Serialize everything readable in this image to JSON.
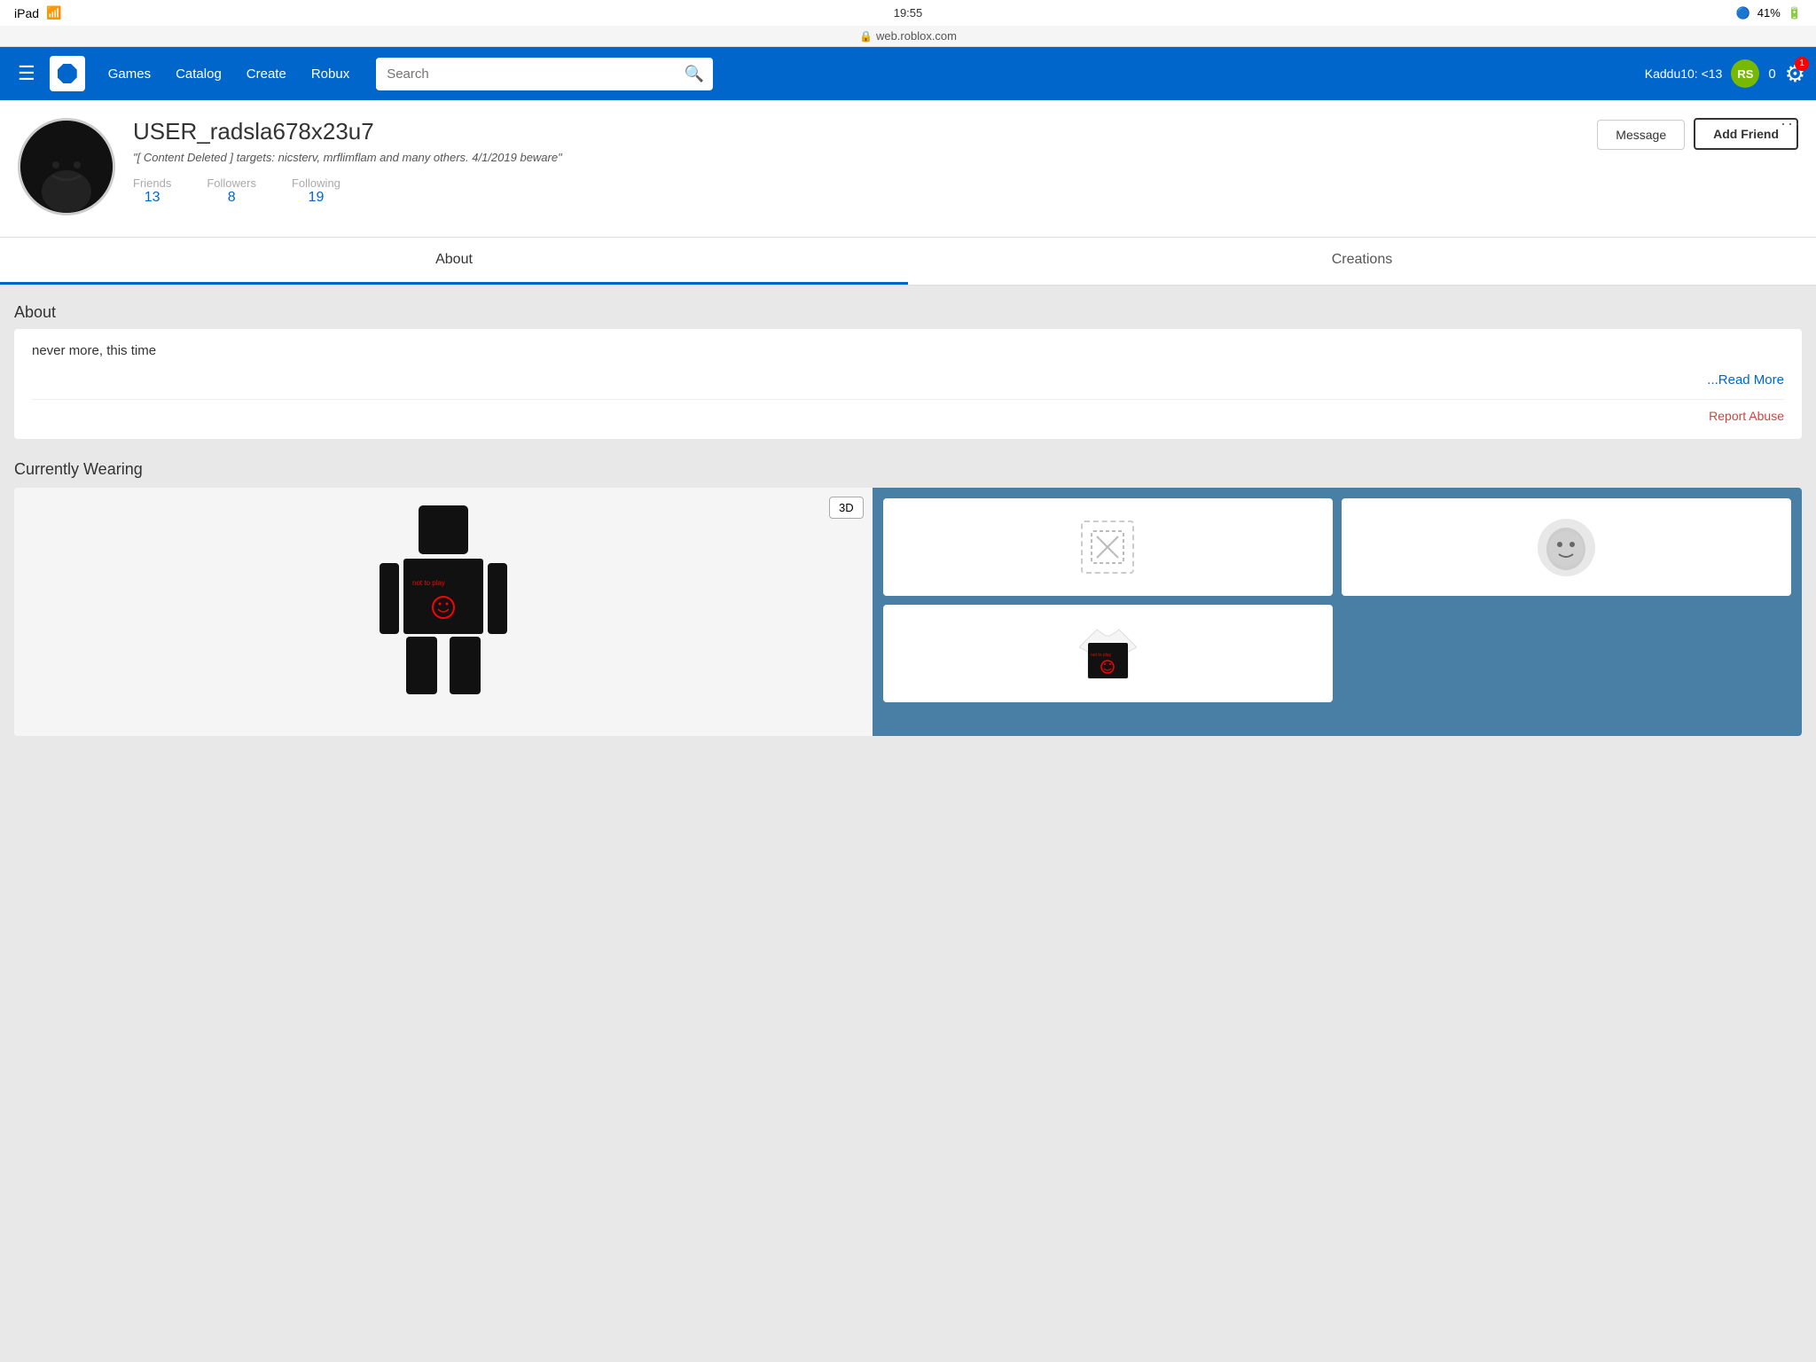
{
  "device": {
    "name": "iPad",
    "time": "19:55",
    "battery": "41%",
    "wifi": true,
    "bluetooth": true
  },
  "browser": {
    "url": "web.roblox.com",
    "lock": true
  },
  "navbar": {
    "menu_icon": "☰",
    "logo_label": "R",
    "links": [
      "Games",
      "Catalog",
      "Create",
      "Robux"
    ],
    "search_placeholder": "Search",
    "search_icon": "🔍",
    "username": "Kaddu10: <13",
    "robux_icon": "RS",
    "robux_count": "0",
    "settings_icon": "⚙",
    "settings_badge": "1"
  },
  "profile": {
    "username": "USER_radsla678x23u7",
    "bio": "\"[ Content Deleted ] targets: nicsterv, mrflimflam and many others. 4/1/2019 beware\"",
    "friends_label": "Friends",
    "friends_count": "13",
    "followers_label": "Followers",
    "followers_count": "8",
    "following_label": "Following",
    "following_count": "19",
    "message_btn": "Message",
    "add_friend_btn": "Add Friend",
    "more_options": "···"
  },
  "tabs": {
    "about_label": "About",
    "creations_label": "Creations"
  },
  "about": {
    "section_title": "About",
    "bio_text": "never more, this time",
    "read_more": "...Read More",
    "report_abuse": "Report Abuse"
  },
  "wearing": {
    "section_title": "Currently Wearing",
    "3d_btn": "3D"
  }
}
